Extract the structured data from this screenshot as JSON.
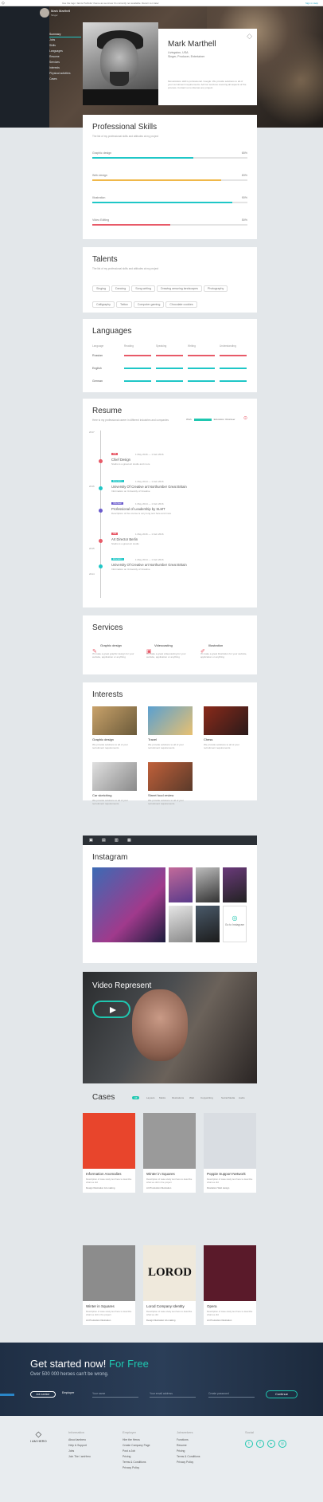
{
  "topbar": {
    "message": "Use the logo 'Jarvis Portfolio' theme as we know it's currently not available. Return to it later",
    "links": "Sign in   Help",
    "logout": "Log in"
  },
  "profile": {
    "name": "Mark Marthell",
    "short_role": "Singer",
    "location": "Livingston, USA",
    "role": "Singer, Producer, Entertainer",
    "bio": "Monetization skill is professional. Google: We provide solutions to all of your recruitment requirements. Ad-hoc services covering all aspects of the process. Contact us to discuss any project."
  },
  "nav": [
    "Summary",
    "Jobs",
    "Skills",
    "Languages",
    "Resume",
    "Services",
    "Interests",
    "Physical activities",
    "Cases"
  ],
  "skills": {
    "title": "Professional Skills",
    "subtitle": "The list of my professional skills and attitudes at my project",
    "items": [
      {
        "label": "Graphic design",
        "value": 65,
        "pct": "65%",
        "color": "#1fc7c7"
      },
      {
        "label": "Web design",
        "value": 83,
        "pct": "83%",
        "color": "#f0b84a"
      },
      {
        "label": "Illustration",
        "value": 90,
        "pct": "90%",
        "color": "#1fc7c7"
      },
      {
        "label": "Video Editing",
        "value": 50,
        "pct": "50%",
        "color": "#e85a68"
      }
    ]
  },
  "talents": {
    "title": "Talents",
    "subtitle": "The list of my professional skills and attitudes at my project",
    "tags": [
      "Singing",
      "Dancing",
      "Song writing",
      "Drawing amazing landscapes",
      "Photography",
      "Calligraphy",
      "Tattoo",
      "Computer gaming",
      "Chocolate cookies"
    ]
  },
  "languages": {
    "title": "Languages",
    "headers": [
      "Language",
      "Reading",
      "Speaking",
      "Writing",
      "Understanding"
    ],
    "rows": [
      {
        "name": "Russian",
        "color": "#e85a68"
      },
      {
        "name": "English",
        "color": "#1fc7c7"
      },
      {
        "name": "German",
        "color": "#1fc7c7"
      }
    ]
  },
  "resume": {
    "title": "Resume",
    "subtitle": "Here is my professional career in different industries and companies",
    "legend": [
      "Work",
      "Education",
      "Volunteer"
    ],
    "years": [
      "2017",
      "2016",
      "2015",
      "2014"
    ],
    "entries": [
      {
        "date": "1 May 2016 — 1 Feb 2016",
        "title": "Chief Design",
        "org": "Studio is a great art studio and more",
        "badge": "Job",
        "badge_color": "#e85a68"
      },
      {
        "date": "1 May 2014 — 1 Feb 2016",
        "title": "University Of Creative art Northumber Great Britain",
        "org": "Information on University of Creative",
        "badge": "Education",
        "badge_color": "#1fc7c7"
      },
      {
        "date": "1 May 2014 — 1 Feb 2016",
        "title": "Professional of Leadership by SLMT",
        "org": "Description of the course is very long text here and more",
        "badge": "Volunteer",
        "badge_color": "#6a5acd"
      },
      {
        "date": "1 May 2016 — 1 Feb 2016",
        "title": "Art Director Berlin",
        "org": "Studio is a great art studio",
        "badge": "Job",
        "badge_color": "#e85a68"
      },
      {
        "date": "1 May 2014 — 1 Feb 2016",
        "title": "University Of Creative art Northumber Great Britain",
        "org": "Information on University of Creative",
        "badge": "Education",
        "badge_color": "#1fc7c7"
      }
    ]
  },
  "services": {
    "title": "Services",
    "items": [
      {
        "name": "Graphic design",
        "desc": "I'll make a great graphic design for your website, application or anything"
      },
      {
        "name": "Videocasting",
        "desc": "I'll make a great videocasting for your website, application or anything"
      },
      {
        "name": "Illustration",
        "desc": "I'll make a great illustration for your website, application or anything"
      }
    ]
  },
  "interests": {
    "title": "Interests",
    "items": [
      {
        "name": "Graphic design",
        "desc": "We provide solutions to all of your recruitment requirements"
      },
      {
        "name": "Travel",
        "desc": "We provide solutions to all of your recruitment requirements"
      },
      {
        "name": "Chess",
        "desc": "We provide solutions to all of your recruitment requirements"
      },
      {
        "name": "Car sketching",
        "desc": "We provide solutions to all of your recruitment requirements"
      },
      {
        "name": "Street food review",
        "desc": "We provide solutions to all of your recruitment requirements"
      }
    ]
  },
  "instagram": {
    "title": "Instagram",
    "go_label": "Go to Instagram"
  },
  "video": {
    "title": "Video Represent"
  },
  "cases": {
    "title": "Cases",
    "filters": [
      "All",
      "Layouts",
      "Marks",
      "Illustrations",
      "Web",
      "Copywriting",
      "Social Media",
      "Audio"
    ],
    "items": [
      {
        "title": "Information Anomalies",
        "desc": "Description of case study text here to describe what we did",
        "tags": "Design   Illustration   Art-making",
        "img": "#e8452c"
      },
      {
        "title": "Winter in Squares",
        "desc": "Description of case study text here to describe what we did in the project",
        "tags": "Art Production   Illustration",
        "img": "#9a9a9a"
      },
      {
        "title": "Poppie Support Network",
        "desc": "Description of case study text here to describe what we did",
        "tags": "Illustration   Web design",
        "img": "#d9dde2"
      },
      {
        "title": "Winter in Squares",
        "desc": "Description of case study text here to describe what we did in the project",
        "tags": "Art Production   Illustration",
        "img": "#8c8c8c"
      },
      {
        "title": "Lorod Company Identity",
        "desc": "Description of case study text here to describe what we did",
        "tags": "Design   Illustration   Art-making",
        "img": "#efe9dc"
      },
      {
        "title": "Opera",
        "desc": "Description of case study text here to describe what we did",
        "tags": "Art Production   Illustration",
        "img": "#5a1a2a"
      }
    ],
    "lorod_text": "LOROD"
  },
  "cta": {
    "headline": "Get started now!",
    "free": "For Free",
    "sub": "Over 500 000 heroes can't be wrong.",
    "roles": [
      "Job seeker",
      "Employer"
    ],
    "fields": [
      "Your name",
      "Your email address",
      "Create password"
    ],
    "button": "Continue"
  },
  "footer": {
    "logo": "I AM HERO",
    "columns": [
      {
        "head": "Information",
        "items": [
          "About iamhero",
          "Help & Support",
          "Jobs",
          "Join The I amHero"
        ]
      },
      {
        "head": "Employer",
        "items": [
          "Hire the Heros",
          "Create Company Page",
          "Post a Job",
          "Pricing",
          "Terms & Conditions",
          "Privacy Policy"
        ]
      },
      {
        "head": "Jobseekers",
        "items": [
          "Functions",
          "Resume",
          "Pricing",
          "Terms & Conditions",
          "Privacy Policy"
        ]
      }
    ],
    "social_head": "Social"
  }
}
